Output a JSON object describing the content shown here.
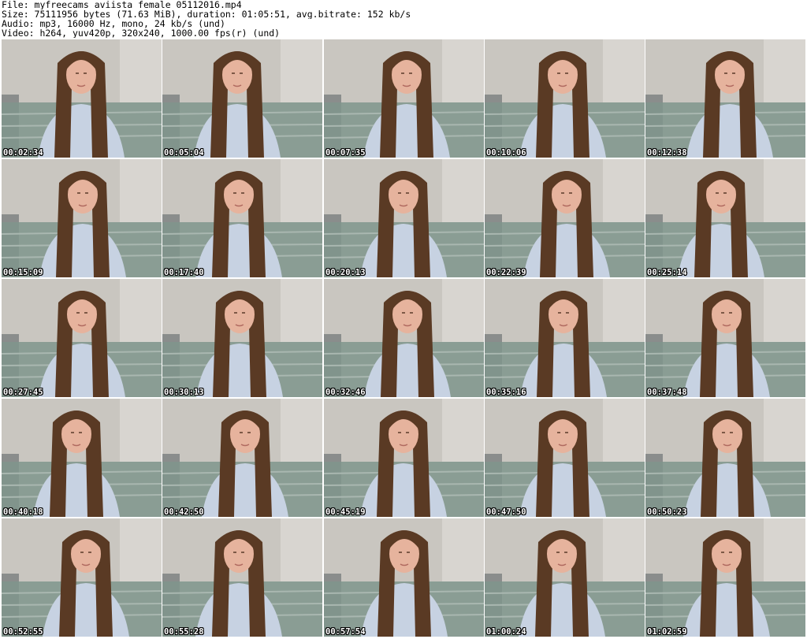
{
  "header": {
    "file_line": "File: myfreecams_aviista_female_05112016.mp4",
    "size_line": "Size: 75111956 bytes (71.63 MiB), duration: 01:05:51, avg.bitrate: 152 kb/s",
    "audio_line": "Audio: mp3, 16000 Hz, mono, 24 kb/s (und)",
    "video_line": "Video: h264, yuv420p, 320x240, 1000.00 fps(r) (und)"
  },
  "thumbnails": [
    {
      "timestamp": "00:02:34"
    },
    {
      "timestamp": "00:05:04"
    },
    {
      "timestamp": "00:07:35"
    },
    {
      "timestamp": "00:10:06"
    },
    {
      "timestamp": "00:12:38"
    },
    {
      "timestamp": "00:15:09"
    },
    {
      "timestamp": "00:17:40"
    },
    {
      "timestamp": "00:20:13"
    },
    {
      "timestamp": "00:22:39"
    },
    {
      "timestamp": "00:25:14"
    },
    {
      "timestamp": "00:27:45"
    },
    {
      "timestamp": "00:30:13"
    },
    {
      "timestamp": "00:32:46"
    },
    {
      "timestamp": "00:35:16"
    },
    {
      "timestamp": "00:37:48"
    },
    {
      "timestamp": "00:40:18"
    },
    {
      "timestamp": "00:42:50"
    },
    {
      "timestamp": "00:45:19"
    },
    {
      "timestamp": "00:47:50"
    },
    {
      "timestamp": "00:50:23"
    },
    {
      "timestamp": "00:52:55"
    },
    {
      "timestamp": "00:55:28"
    },
    {
      "timestamp": "00:57:54"
    },
    {
      "timestamp": "01:00:24"
    },
    {
      "timestamp": "01:02:59"
    }
  ],
  "colors": {
    "wall": "#c9c6c0",
    "hair": "#5a3a24",
    "shirt": "#c7d2e2",
    "skin": "#e6b39d",
    "bedding": "#7f958c"
  }
}
